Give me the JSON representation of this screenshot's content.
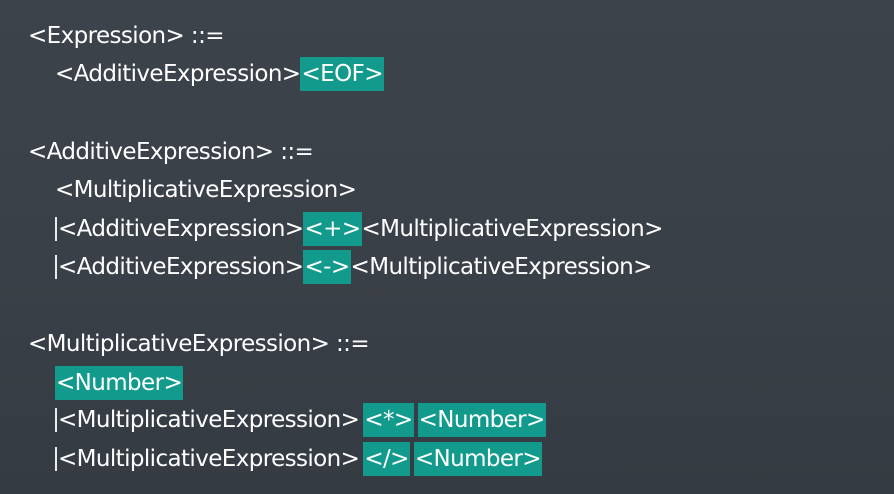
{
  "grammar": {
    "expression": {
      "head": "<Expression>",
      "op": "::=",
      "rule1_part1": "<AdditiveExpression>",
      "rule1_part2": "<EOF>"
    },
    "additive": {
      "head": "<AdditiveExpression>",
      "op": "::=",
      "alt1": "<MultiplicativeExpression>",
      "alt2_part1": "<AdditiveExpression>",
      "alt2_op": "<+>",
      "alt2_part2": "<MultiplicativeExpression>",
      "alt3_part1": "<AdditiveExpression>",
      "alt3_op": "<->",
      "alt3_part2": "<MultiplicativeExpression>"
    },
    "multiplicative": {
      "head": "<MultiplicativeExpression>",
      "op": "::=",
      "alt1": "<Number>",
      "alt2_part1": "<MultiplicativeExpression>",
      "alt2_op": "<*>",
      "alt2_part2": "<Number>",
      "alt3_part1": "<MultiplicativeExpression>",
      "alt3_op": "</>",
      "alt3_part2": "<Number>"
    }
  },
  "colors": {
    "background": "#3a4047",
    "highlight": "#129a8d",
    "text": "#ffffff"
  }
}
